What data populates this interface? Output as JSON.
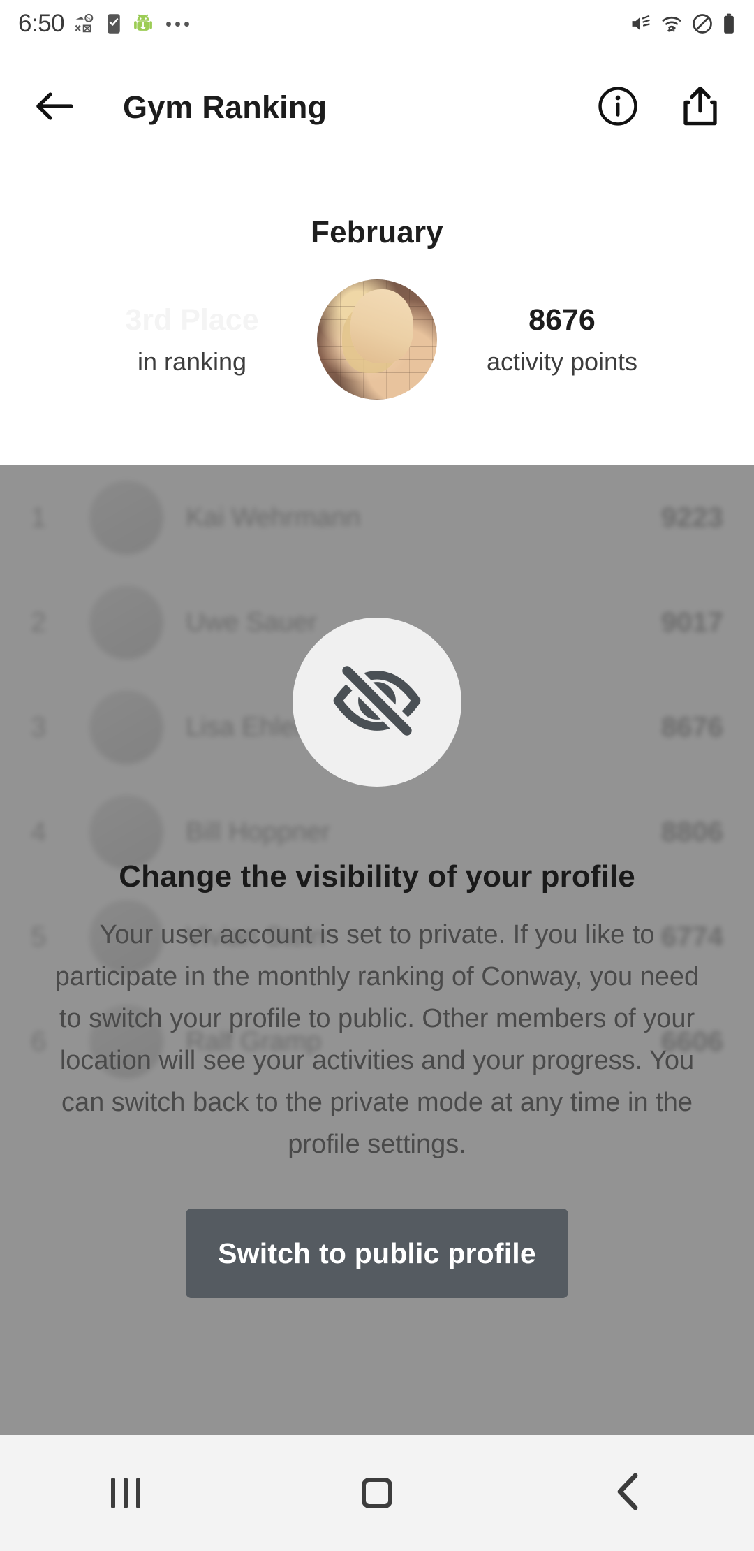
{
  "status_bar": {
    "time": "6:50",
    "left_icons": [
      "transfer-failed-icon",
      "checklist-icon",
      "android-icon",
      "more-notifications-icon"
    ],
    "right_icons": [
      "mute-icon",
      "wifi-icon",
      "do-not-disturb-icon",
      "battery-icon"
    ]
  },
  "app_bar": {
    "back_label": "back-arrow",
    "title": "Gym Ranking",
    "info_label": "info",
    "share_label": "share"
  },
  "month_header": {
    "month": "February",
    "rank_value": "3rd Place",
    "rank_label": "in ranking",
    "points_value": "8676",
    "points_label": "activity points",
    "avatar_alt": "user-profile-photo"
  },
  "ranking_list": {
    "rows": [
      {
        "rank": "1",
        "name": "Kai Wehrmann",
        "score": "9223"
      },
      {
        "rank": "2",
        "name": "Uwe Sauer",
        "score": "9017"
      },
      {
        "rank": "3",
        "name": "Lisa Ehlers",
        "score": "8676"
      },
      {
        "rank": "4",
        "name": "Bill Hoppner",
        "score": "8806"
      },
      {
        "rank": "5",
        "name": "Vivian Stein",
        "score": "6774"
      },
      {
        "rank": "6",
        "name": "Ralf Gramp",
        "score": "6606"
      }
    ]
  },
  "dialog": {
    "icon": "eye-off-icon",
    "title": "Change the visibility of your profile",
    "body": "Your user account is set to private. If you like to participate in the monthly ranking of Conway, you need to switch your profile to public. Other members of your location will see your activities and your progress. You can switch back to the private mode at any time in the profile settings.",
    "button_label": "Switch to public profile"
  },
  "nav_bar": {
    "recents_label": "recents",
    "home_label": "home",
    "back_label": "back"
  },
  "colors": {
    "button_bg": "#555b61",
    "icon_dark": "#4a5055",
    "scrim": "rgba(120,120,120,0.80)",
    "faded_text": "#f4f4f4"
  }
}
